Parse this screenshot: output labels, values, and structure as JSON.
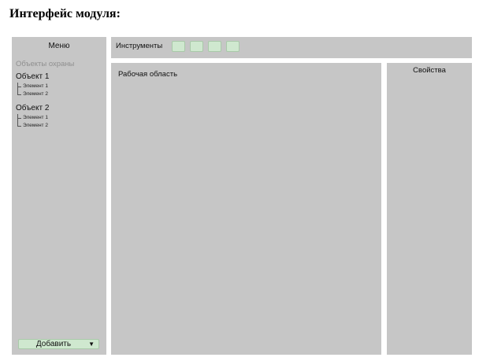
{
  "heading": "Интерфейс модуля:",
  "menu": {
    "title": "Меню",
    "section_label": "Объекты охраны",
    "objects": [
      {
        "name": "Объект 1",
        "elements": [
          "Элемент 1",
          "Элемент 2"
        ]
      },
      {
        "name": "Объект 2",
        "elements": [
          "Элемент 1",
          "Элемент 2"
        ]
      }
    ],
    "add_button": {
      "label": "Добавить",
      "icon": "dropdown-triangle-icon"
    }
  },
  "toolbar": {
    "label": "Инструменты",
    "tool_buttons": [
      "tool-1",
      "tool-2",
      "tool-3",
      "tool-4"
    ]
  },
  "workspace": {
    "label": "Рабочая область"
  },
  "properties": {
    "label": "Свойства"
  },
  "colors": {
    "panel": "#c6c6c6",
    "button": "#cfe8cf",
    "muted_text": "#8f8f8f"
  }
}
